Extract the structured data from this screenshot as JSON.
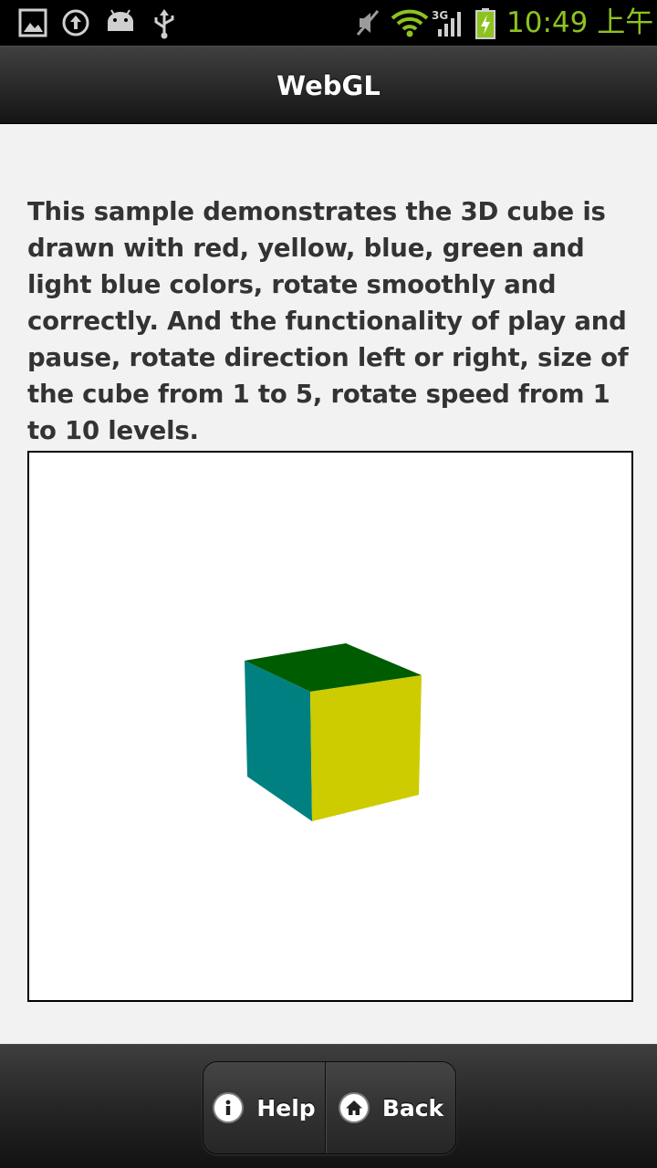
{
  "status_bar": {
    "time": "10:49 上午",
    "network": "3G",
    "time_color": "#8ec21f",
    "icons_left": [
      "gallery-notification-icon",
      "sync-icon",
      "android-debug-icon",
      "usb-icon"
    ],
    "icons_right": [
      "mute-icon",
      "wifi-icon",
      "signal-icon",
      "battery-charging-icon"
    ]
  },
  "header": {
    "title": "WebGL"
  },
  "main": {
    "description": "This sample demonstrates the 3D cube is drawn with red, yellow, blue, green and light blue colors, rotate smoothly and correctly. And the functionality of play and pause, rotate direction left or right, size of the cube from 1 to 5, rotate speed from 1 to 10 levels.",
    "cube_colors": {
      "top": "#005c00",
      "left": "#008080",
      "front": "#cccc00"
    }
  },
  "footer": {
    "buttons": [
      {
        "label": "Help",
        "icon": "info-icon"
      },
      {
        "label": "Back",
        "icon": "home-icon"
      }
    ]
  }
}
